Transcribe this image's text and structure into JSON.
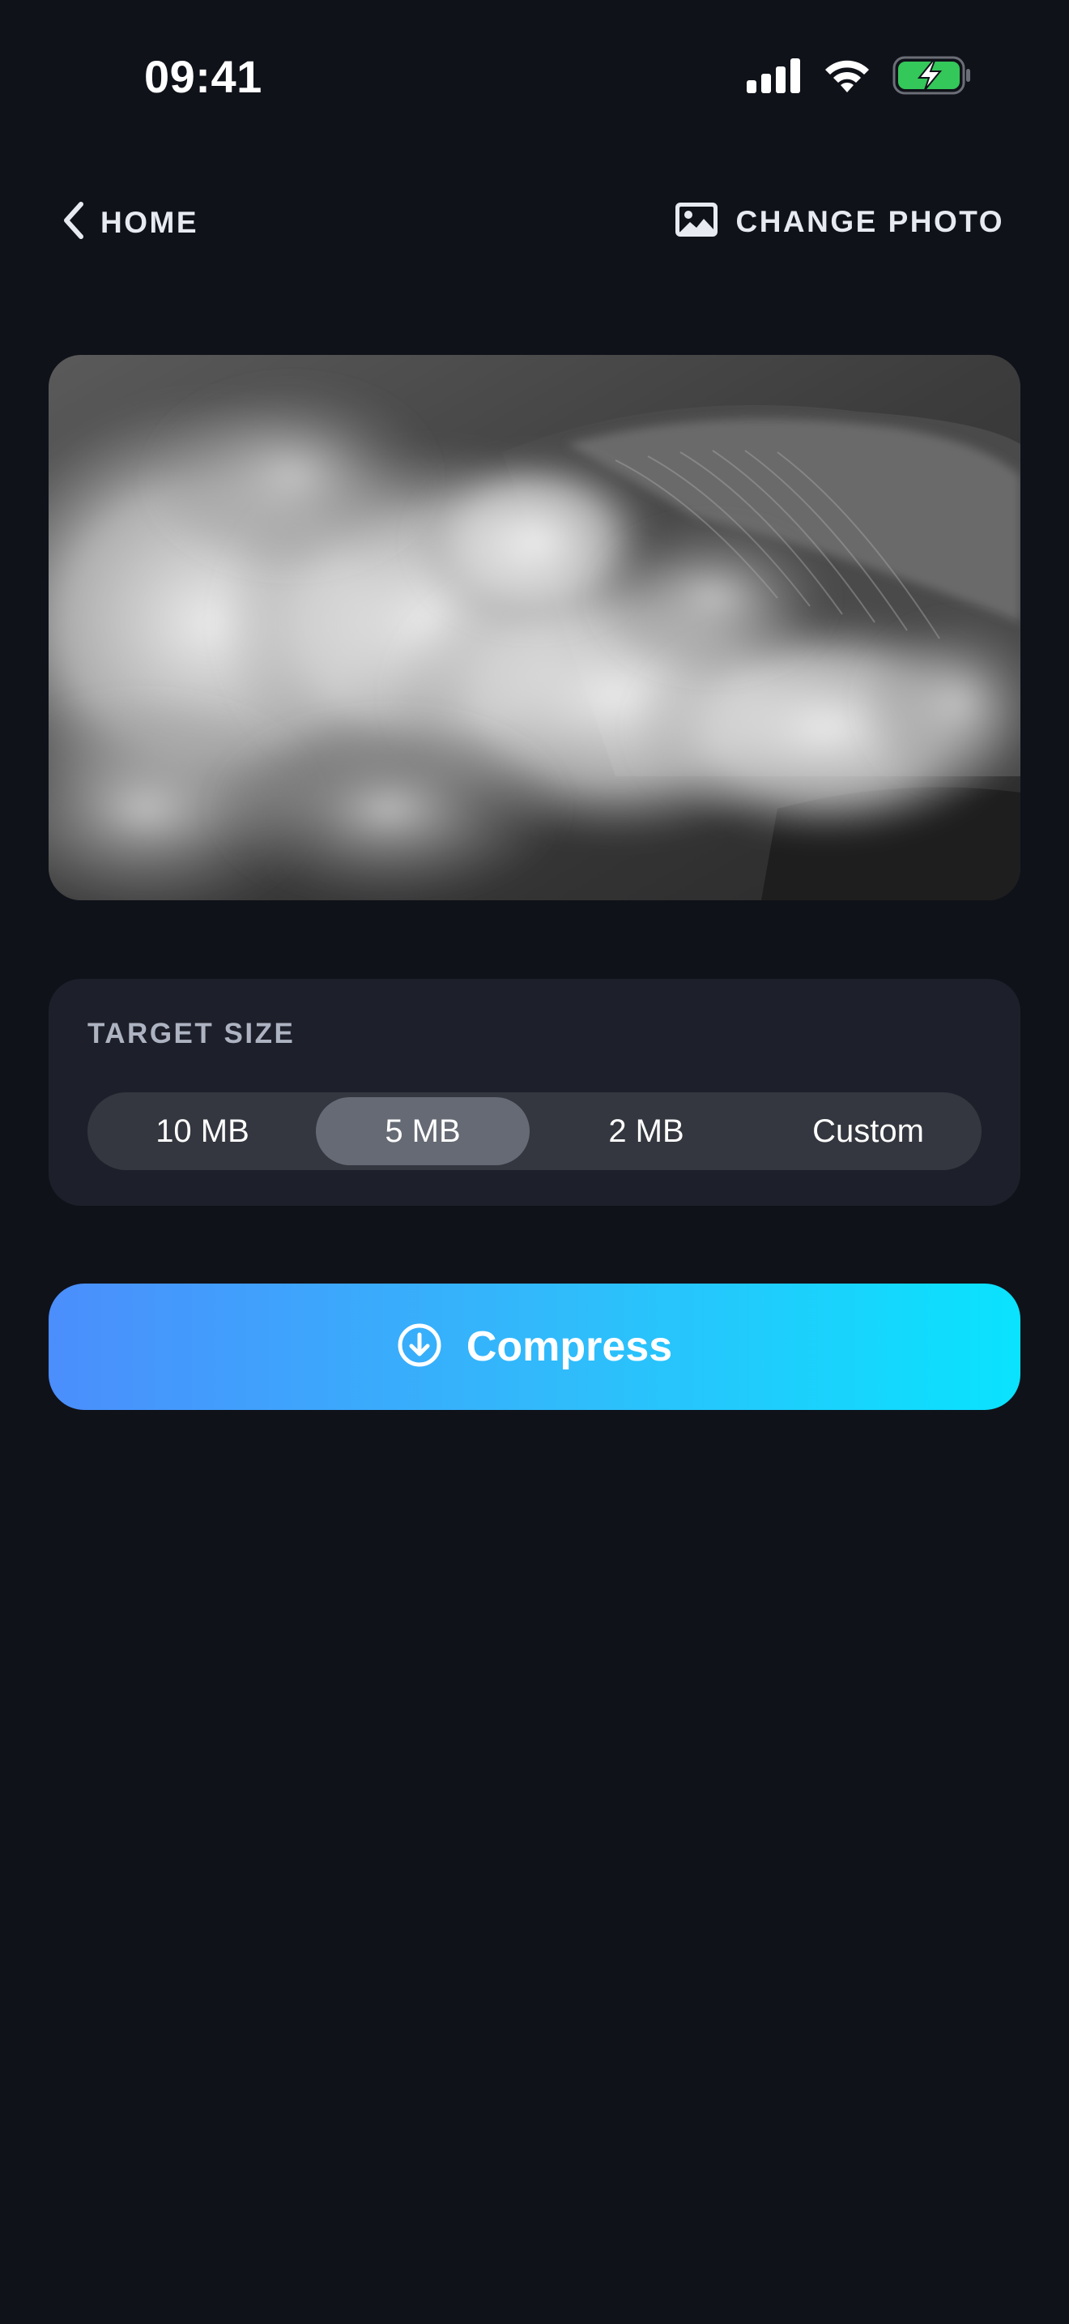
{
  "status_bar": {
    "time": "09:41",
    "icons": [
      "cellular-signal-icon",
      "wifi-icon",
      "battery-charging-icon"
    ]
  },
  "nav": {
    "back_label": "HOME",
    "back_icon": "chevron-left-icon",
    "change_label": "CHANGE PHOTO",
    "change_icon": "photo-icon"
  },
  "photo": {
    "subject": "black-and-white ocean wave spray"
  },
  "target_size": {
    "title": "TARGET SIZE",
    "options": [
      {
        "label": "10 MB",
        "selected": false
      },
      {
        "label": "5 MB",
        "selected": true
      },
      {
        "label": "2 MB",
        "selected": false
      },
      {
        "label": "Custom",
        "selected": false
      }
    ]
  },
  "compress_button": {
    "label": "Compress",
    "icon": "download-circle-icon"
  },
  "colors": {
    "background": "#10121a",
    "card": "#1d202a",
    "segment_track": "#34373f",
    "segment_selected": "#666a74",
    "gradient_start": "#4b8efc",
    "gradient_end": "#09e3fe",
    "battery_fill": "#34c759"
  }
}
